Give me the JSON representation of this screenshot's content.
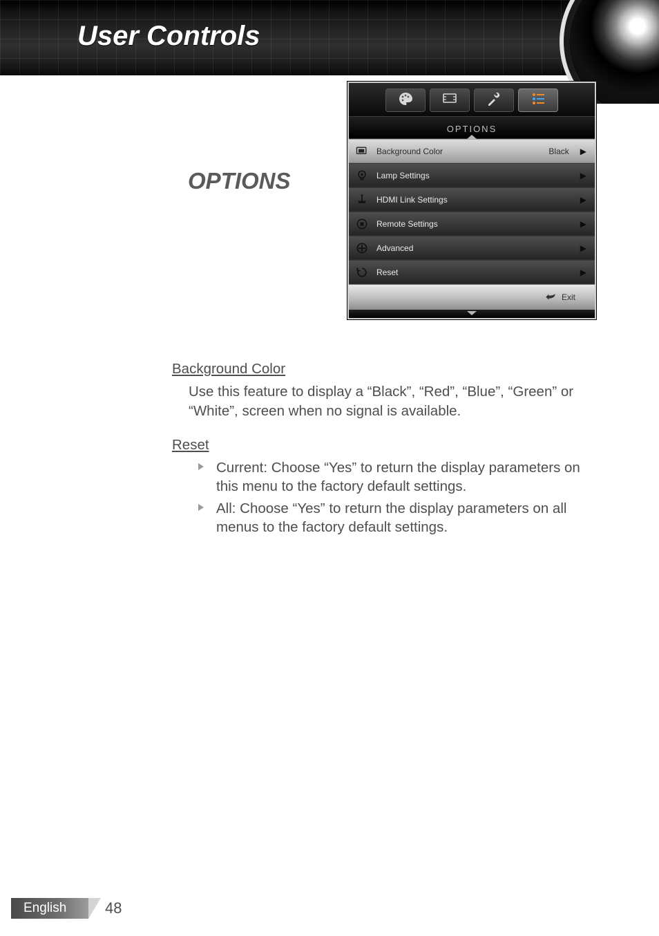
{
  "header": {
    "title": "User Controls"
  },
  "section_title": "OPTIONS",
  "osd": {
    "category_label": "OPTIONS",
    "tabs": [
      {
        "name": "picture-tab-icon"
      },
      {
        "name": "display-tab-icon"
      },
      {
        "name": "setup-tab-icon"
      },
      {
        "name": "options-tab-icon",
        "selected": true
      }
    ],
    "items": [
      {
        "icon": "display-icon",
        "label": "Background Color",
        "value": "Black",
        "highlight": true
      },
      {
        "icon": "lamp-icon",
        "label": "Lamp Settings",
        "value": ""
      },
      {
        "icon": "hdmi-icon",
        "label": "HDMI Link Settings",
        "value": ""
      },
      {
        "icon": "remote-icon",
        "label": "Remote Settings",
        "value": ""
      },
      {
        "icon": "advanced-icon",
        "label": "Advanced",
        "value": ""
      },
      {
        "icon": "reset-icon",
        "label": "Reset",
        "value": ""
      }
    ],
    "exit_label": "Exit"
  },
  "body": {
    "bg_heading": "Background Color",
    "bg_paragraph": "Use this feature to display a “Black”, “Red”, “Blue”, “Green” or “White”, screen when no signal is available.",
    "reset_heading": "Reset",
    "reset_items": [
      "Current: Choose “Yes” to return the display parameters on this menu to the factory default settings.",
      "All: Choose “Yes” to return the display parameters on all menus to the factory default settings."
    ]
  },
  "footer": {
    "language": "English",
    "page": "48"
  }
}
